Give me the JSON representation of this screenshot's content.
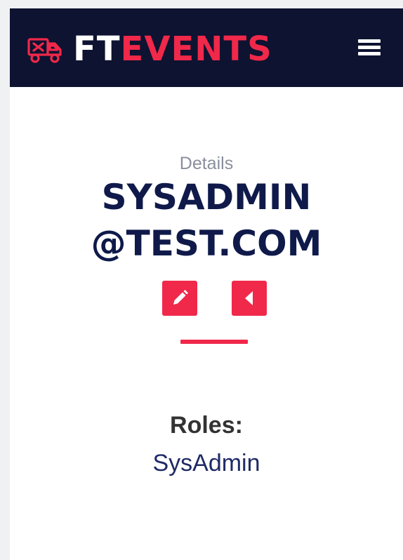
{
  "header": {
    "brand_first": "FT",
    "brand_second": "EVENTS",
    "brand_icon": "truck-icon",
    "menu_icon": "hamburger-menu-icon"
  },
  "main": {
    "subtitle": "Details",
    "title_line1": "SYSADMIN",
    "title_line2": "@TEST.COM",
    "actions": [
      {
        "name": "edit-button",
        "icon": "pencil-icon"
      },
      {
        "name": "back-button",
        "icon": "caret-left-icon"
      }
    ],
    "roles_label": "Roles:",
    "roles_value": "SysAdmin"
  },
  "colors": {
    "navbar_bg": "#0d1330",
    "accent": "#f0284a",
    "title": "#0f1a4a",
    "subtitle": "#8a8f9c",
    "roles_value": "#1f2a66"
  }
}
